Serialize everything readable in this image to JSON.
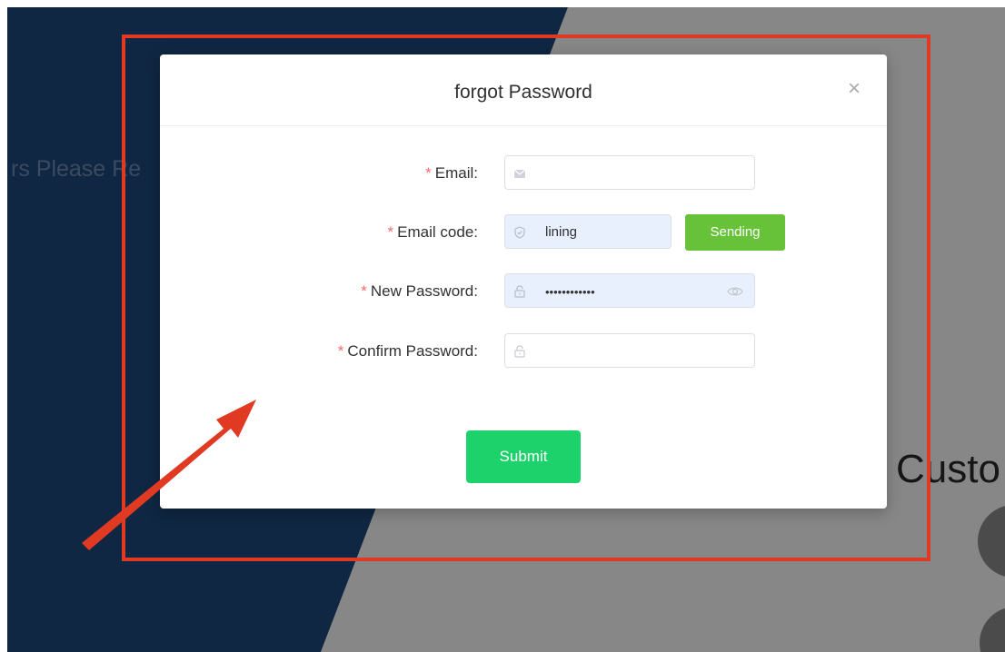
{
  "background": {
    "left_text": "rs Please Re",
    "right_text": "Custo"
  },
  "modal": {
    "title": "forgot Password",
    "close_icon": "×",
    "fields": {
      "email": {
        "required_mark": "*",
        "label": "Email:",
        "value": "",
        "icon": "mail-icon"
      },
      "email_code": {
        "required_mark": "*",
        "label": "Email code:",
        "value": "lining",
        "icon": "shield-icon"
      },
      "new_password": {
        "required_mark": "*",
        "label": "New Password:",
        "value": "••••••••••••",
        "icon": "lock-icon"
      },
      "confirm_password": {
        "required_mark": "*",
        "label": "Confirm Password:",
        "value": "",
        "icon": "lock-icon"
      }
    },
    "send_button": "Sending",
    "submit_button": "Submit"
  },
  "colors": {
    "background_blue": "#1e4a7e",
    "required": "#f56c6c",
    "send_button": "#67c23a",
    "submit_button": "#1dd26a",
    "annotation": "#e03a22"
  }
}
